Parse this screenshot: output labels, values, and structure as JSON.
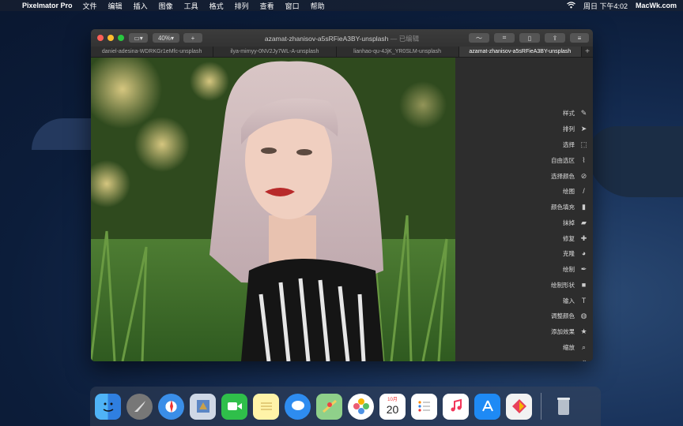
{
  "menubar": {
    "apple": "",
    "app_name": "Pixelmator Pro",
    "menus": [
      "文件",
      "编辑",
      "插入",
      "图像",
      "工具",
      "格式",
      "排列",
      "查看",
      "窗口",
      "帮助"
    ],
    "clock": "周日 下午4:02",
    "site": "MacWk.com"
  },
  "window": {
    "zoom": "40%",
    "title": "azamat-zhanisov-a5sRFieA3BY-unsplash",
    "title_status": "— 已编辑",
    "tabs": [
      "daniel-adesina-WDRKGr1eMfc-unsplash",
      "ilya-mirnyy-0NV2Jy7WL-A-unsplash",
      "lianhao-qu-4JjK_YR0SLM-unsplash",
      "azamat-zhanisov-a5sRFieA3BY-unsplash"
    ],
    "active_tab": 3
  },
  "tools": [
    {
      "label": "样式",
      "icon": "style-icon",
      "glyph": "✎"
    },
    {
      "label": "排列",
      "icon": "arrange-pointer-icon",
      "glyph": "➤"
    },
    {
      "label": "选择",
      "icon": "select-marquee-icon",
      "glyph": "⬚"
    },
    {
      "label": "自由选区",
      "icon": "lasso-icon",
      "glyph": "⌇"
    },
    {
      "label": "选择颜色",
      "icon": "eyedropper-icon",
      "glyph": "⊘"
    },
    {
      "label": "绘图",
      "icon": "brush-icon",
      "glyph": "/"
    },
    {
      "label": "颜色填充",
      "icon": "paint-bucket-icon",
      "glyph": "▮"
    },
    {
      "label": "抹掉",
      "icon": "eraser-icon",
      "glyph": "▰"
    },
    {
      "label": "修复",
      "icon": "bandage-icon",
      "glyph": "✚"
    },
    {
      "label": "克隆",
      "icon": "clone-stamp-icon",
      "glyph": "◕"
    },
    {
      "label": "绘制",
      "icon": "pen-nib-icon",
      "glyph": "✒"
    },
    {
      "label": "绘制形状",
      "icon": "shape-icon",
      "glyph": "■"
    },
    {
      "label": "输入",
      "icon": "text-icon",
      "glyph": "T"
    },
    {
      "label": "调整颜色",
      "icon": "color-adjust-icon",
      "glyph": "◍"
    },
    {
      "label": "添加效果",
      "icon": "effects-star-icon",
      "glyph": "★"
    },
    {
      "label": "缩放",
      "icon": "zoom-magnifier-icon",
      "glyph": "⌕"
    }
  ],
  "more_tools": "»",
  "dock": {
    "calendar_month": "10月",
    "calendar_day": "20"
  }
}
